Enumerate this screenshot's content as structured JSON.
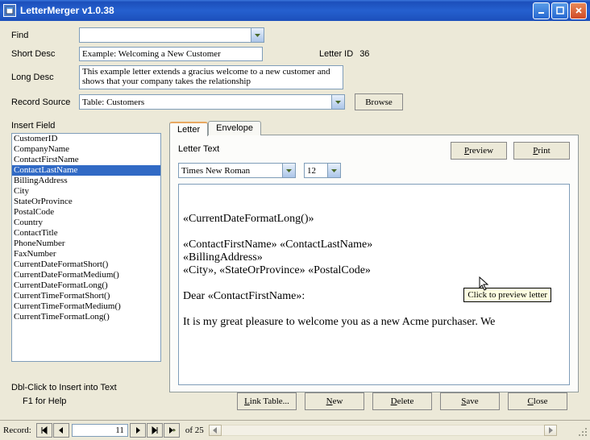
{
  "window": {
    "title": "LetterMerger v1.0.38"
  },
  "labels": {
    "find": "Find",
    "short_desc": "Short Desc",
    "long_desc": "Long Desc",
    "record_source": "Record Source",
    "letter_id": "Letter ID",
    "insert_field": "Insert Field",
    "dblclick": "Dbl-Click to Insert into Text",
    "f1": "F1 for Help",
    "letter_text": "Letter Text",
    "record": "Record:"
  },
  "form": {
    "find": "",
    "short_desc": "Example: Welcoming a New Customer",
    "long_desc": "This example letter extends a gracius welcome to a new customer and shows that your company takes the relationship",
    "record_source": "Table: Customers",
    "letter_id": "36",
    "font_family": "Times New Roman",
    "font_size": "12"
  },
  "buttons": {
    "browse": "Browse",
    "preview": "Preview",
    "print": "Print",
    "link_table": "Link Table...",
    "new": "New",
    "delete": "Delete",
    "save": "Save",
    "close": "Close"
  },
  "tooltip": "Click to preview letter",
  "tabs": {
    "letter": "Letter",
    "envelope": "Envelope"
  },
  "fields": [
    "CustomerID",
    "CompanyName",
    "ContactFirstName",
    "ContactLastName",
    "BillingAddress",
    "City",
    "StateOrProvince",
    "PostalCode",
    "Country",
    "ContactTitle",
    "PhoneNumber",
    "FaxNumber",
    "CurrentDateFormatShort()",
    "CurrentDateFormatMedium()",
    "CurrentDateFormatLong()",
    "CurrentTimeFormatShort()",
    "CurrentTimeFormatMedium()",
    "CurrentTimeFormatLong()"
  ],
  "selected_field_index": 3,
  "letter_lines": {
    "l1": "«CurrentDateFormatLong()»",
    "l2": "«ContactFirstName» «ContactLastName»",
    "l3": "«BillingAddress»",
    "l4": "«City», «StateOrProvince» «PostalCode»",
    "l5": "Dear «ContactFirstName»:",
    "l6": "It is my great pleasure to welcome you as a new Acme purchaser.  We"
  },
  "nav": {
    "current": "11",
    "of_text": "of  25"
  }
}
